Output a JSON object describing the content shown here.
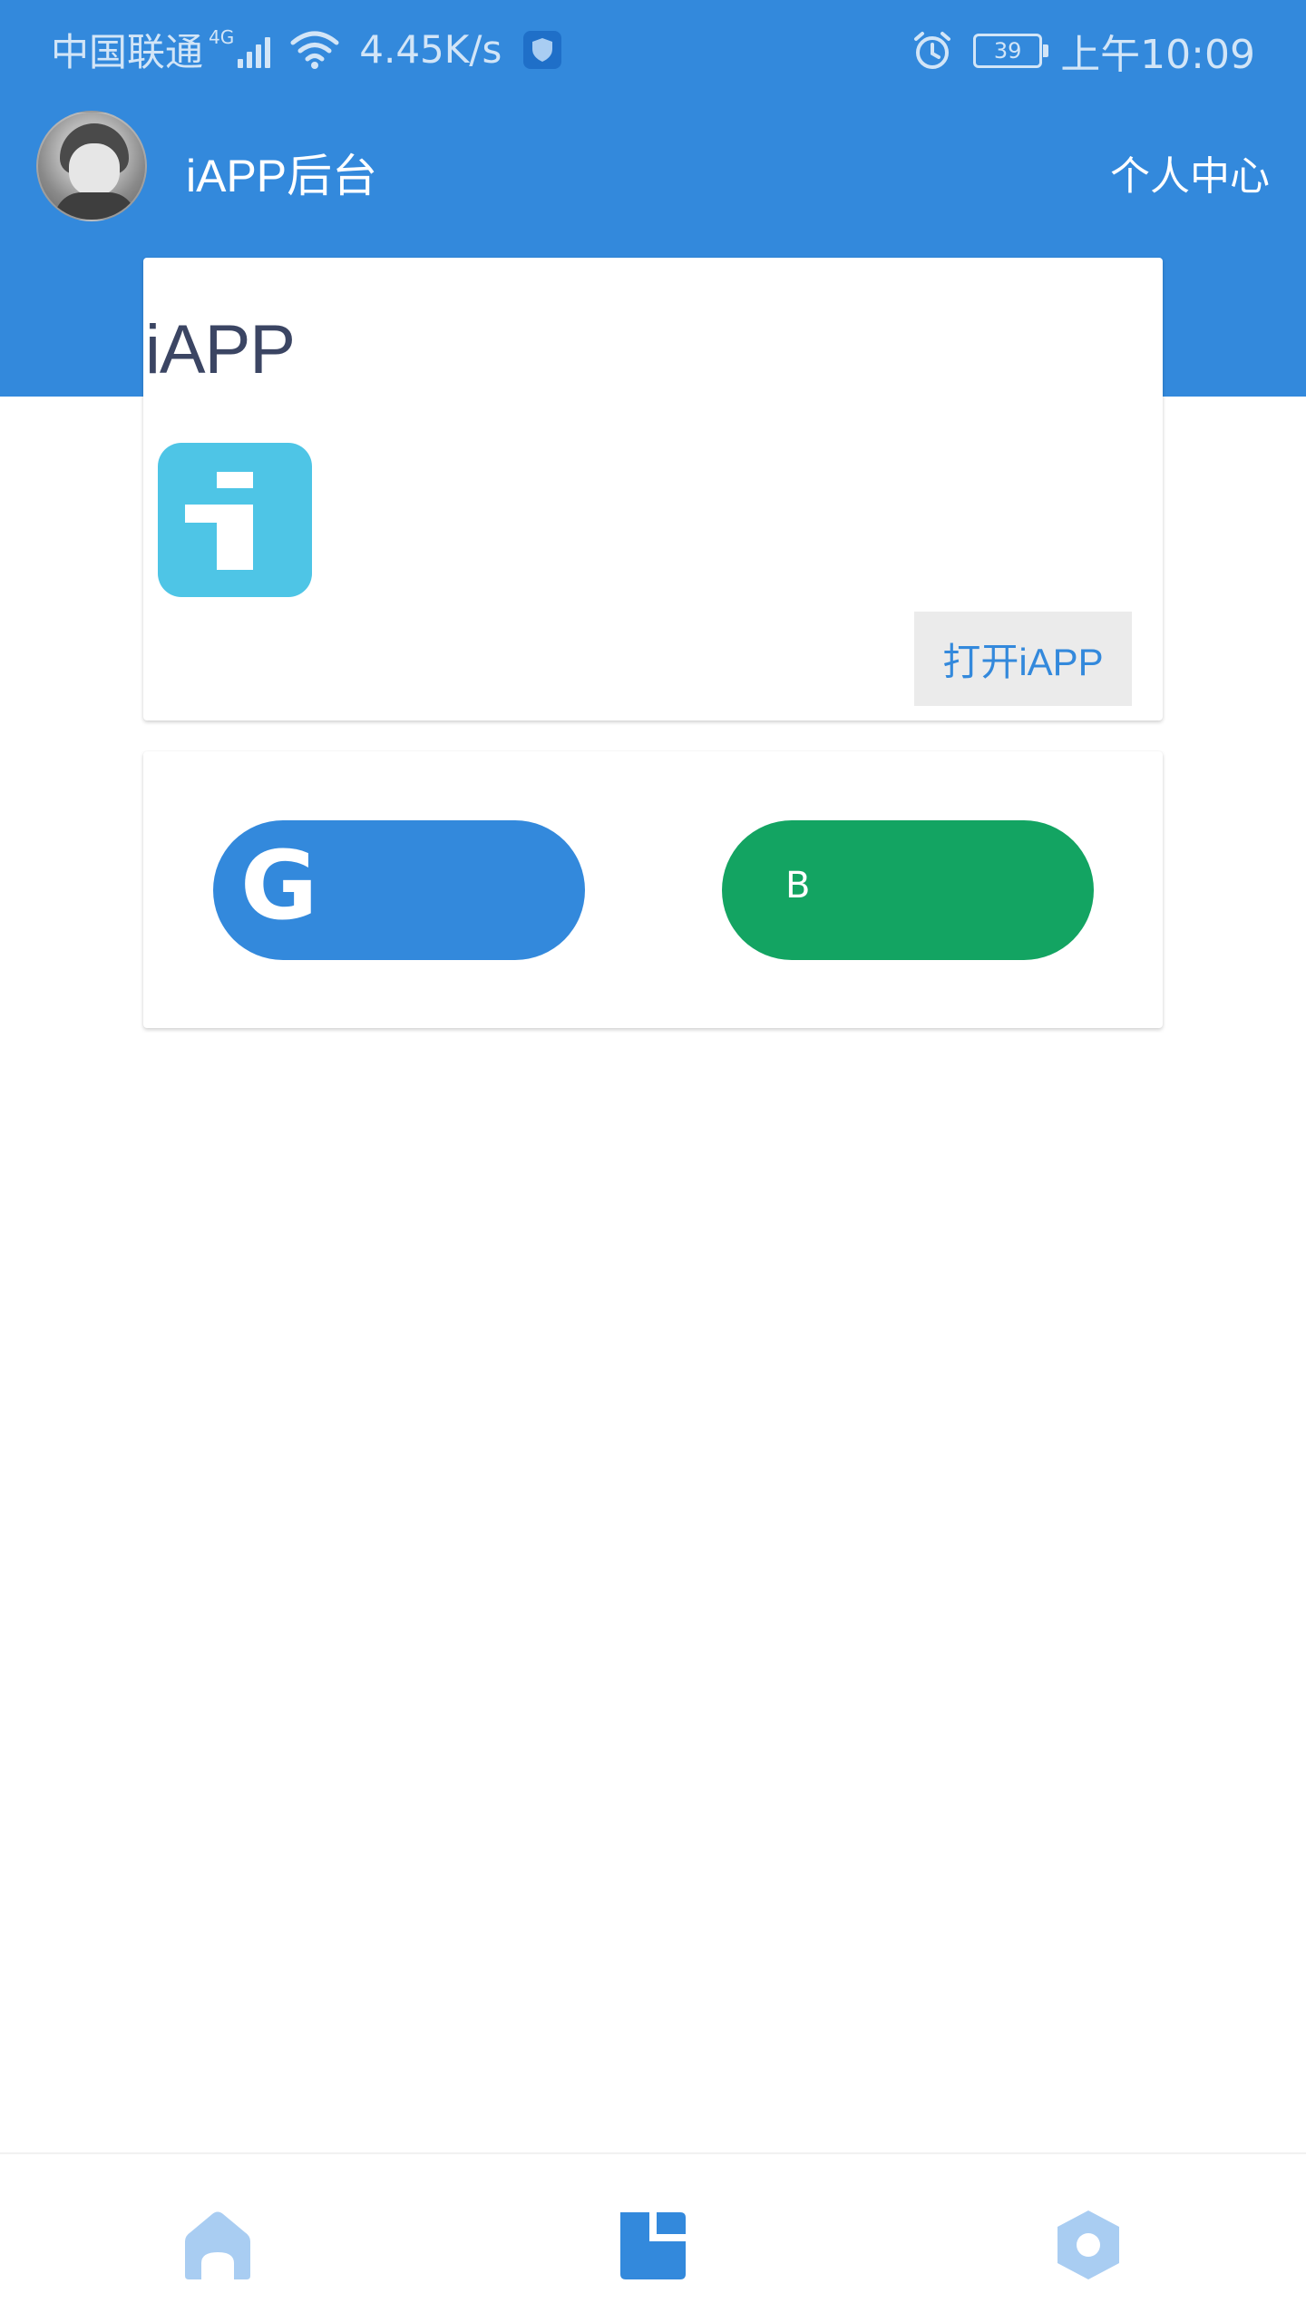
{
  "status_bar": {
    "carrier": "中国联通",
    "network": "4G",
    "speed": "4.45K/s",
    "battery": "39",
    "time": "上午10:09"
  },
  "app_bar": {
    "title": "iAPP后台",
    "personal_center": "个人中心"
  },
  "app_card": {
    "title": "iAPP",
    "icon": "iapp-logo-icon",
    "open_button": "打开iAPP"
  },
  "button_card": {
    "left_button_letter": "G",
    "right_button_letter": "B",
    "left_color": "#3389dc",
    "right_color": "#13a462"
  },
  "bottom_nav": {
    "items": [
      {
        "icon": "home-icon",
        "active": false
      },
      {
        "icon": "dashboard-icon",
        "active": true
      },
      {
        "icon": "settings-icon",
        "active": false
      }
    ]
  },
  "colors": {
    "primary": "#3389dc",
    "primary_light": "#a9cdf2",
    "green": "#13a462",
    "icon_cyan": "#4ec5e6",
    "title_text": "#3b4563"
  }
}
